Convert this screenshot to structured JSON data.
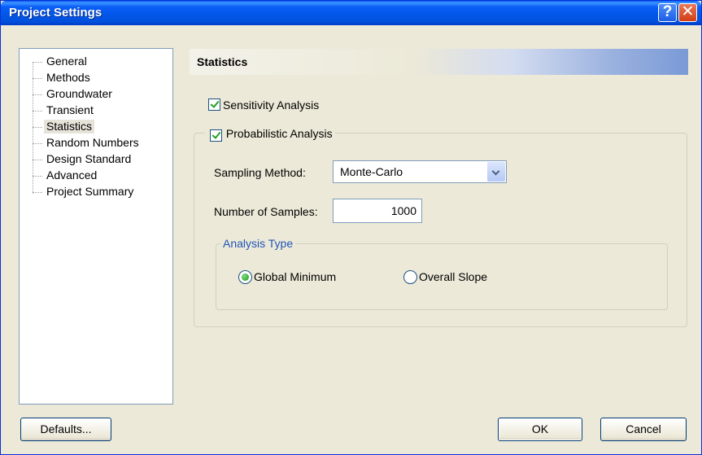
{
  "window": {
    "title": "Project Settings"
  },
  "titlebar": {
    "help_glyph": "?",
    "close_glyph": "✕"
  },
  "tree": {
    "items": [
      {
        "label": "General"
      },
      {
        "label": "Methods"
      },
      {
        "label": "Groundwater"
      },
      {
        "label": "Transient"
      },
      {
        "label": "Statistics",
        "selected": true
      },
      {
        "label": "Random Numbers"
      },
      {
        "label": "Design Standard"
      },
      {
        "label": "Advanced"
      },
      {
        "label": "Project Summary"
      }
    ]
  },
  "panel": {
    "header": "Statistics",
    "sensitivity": {
      "label": "Sensitivity Analysis",
      "checked": true
    },
    "probabilistic": {
      "label": "Probabilistic Analysis",
      "checked": true
    },
    "sampling_method": {
      "label": "Sampling Method:",
      "value": "Monte-Carlo"
    },
    "num_samples": {
      "label": "Number of Samples:",
      "value": "1000"
    },
    "analysis_type": {
      "legend": "Analysis Type",
      "options": [
        {
          "label": "Global Minimum",
          "selected": true
        },
        {
          "label": "Overall Slope",
          "selected": false
        }
      ]
    }
  },
  "buttons": {
    "defaults": "Defaults...",
    "ok": "OK",
    "cancel": "Cancel"
  },
  "colors": {
    "titlebar": "#0a5ef7",
    "check": "#21a121",
    "legend_text": "#2155b8"
  }
}
